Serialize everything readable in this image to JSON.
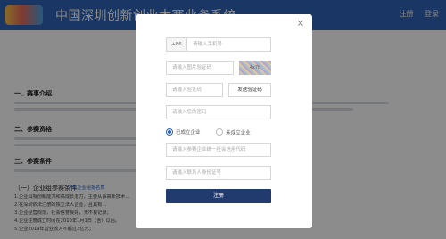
{
  "header": {
    "title": "中国深圳创新创业大赛业务系统",
    "links": [
      "注册",
      "登录"
    ]
  },
  "content": {
    "section1": "一、赛事介绍",
    "section2": "二、参赛资格",
    "section3": "三、参赛条件",
    "subhead1": "（一）企业组参赛条件",
    "download_link": "下载企业组报名表",
    "list_items": [
      "1.企业具有创新能力和高成长潜力，主要从事高新技术…",
      "2.在深圳依法注册的独立法人企业，且具有…",
      "3.企业经营规范，社会信誉良好，无不良记录；",
      "4.企业注册成立时间在2010年1月1日（含）以后。",
      "5.企业2019年营业收入不超过2亿元；"
    ]
  },
  "modal": {
    "phone_prefix": "+86",
    "phone_placeholder": "请输入手机号",
    "captcha_placeholder": "请输入图片验证码",
    "captcha_text": "4x7b",
    "sms_placeholder": "请输入验证码",
    "sms_button": "发送验证码",
    "password_placeholder": "请输入您的密码",
    "radio_options": [
      "已成立企业",
      "未成立企业"
    ],
    "credit_code_placeholder": "请输入参赛企业统一社会信用代码",
    "contact_id_placeholder": "请输入联系人身份证号",
    "submit": "注册",
    "close": "×"
  }
}
